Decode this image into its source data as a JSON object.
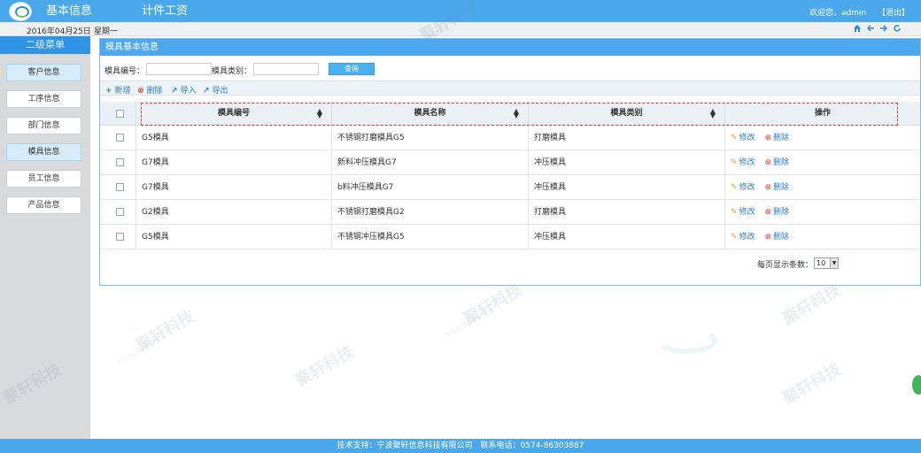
{
  "header": {
    "nav": [
      "基本信息",
      "计件工资"
    ],
    "welcome": "欢迎您，admin",
    "logout": "【退出】"
  },
  "datebar": {
    "date": "2016年04月25日",
    "weekday": "星期一",
    "icons": [
      "home-icon",
      "back-arrow-icon",
      "forward-arrow-icon",
      "refresh-icon"
    ]
  },
  "sidebar": {
    "title": "二级菜单",
    "items": [
      {
        "label": "客户信息",
        "active": true
      },
      {
        "label": "工序信息",
        "active": false
      },
      {
        "label": "部门信息",
        "active": false
      },
      {
        "label": "模具信息",
        "active": true
      },
      {
        "label": "员工信息",
        "active": false
      },
      {
        "label": "产品信息",
        "active": false
      }
    ]
  },
  "panel": {
    "title": "模具基本信息",
    "search": {
      "code_label": "模具编号：",
      "type_label": "模具类别：",
      "code_value": "",
      "type_value": "",
      "button": "查询"
    },
    "toolbar": {
      "add": "新增",
      "delete": "删除",
      "import": "导入",
      "export": "导出"
    },
    "table": {
      "columns": [
        "模具编号",
        "模具名称",
        "模具类别",
        "操作"
      ],
      "rows": [
        {
          "code": "G5模具",
          "name": "不锈钢打磨模具G5",
          "type": "打磨模具",
          "edit": "修改",
          "del": "删除"
        },
        {
          "code": "G7模具",
          "name": "新料冲压模具G7",
          "type": "冲压模具",
          "edit": "修改",
          "del": "删除"
        },
        {
          "code": "G7模具",
          "name": "b料冲压模具G7",
          "type": "冲压模具",
          "edit": "修改",
          "del": "删除"
        },
        {
          "code": "G2模具",
          "name": "不锈钢打磨模具G2",
          "type": "打磨模具",
          "edit": "修改",
          "del": "删除"
        },
        {
          "code": "G5模具",
          "name": "不锈钢冲压模具G5",
          "type": "冲压模具",
          "edit": "修改",
          "del": "删除"
        }
      ]
    },
    "pager": {
      "label": "每页显示条数：",
      "value": "10"
    }
  },
  "watermark": {
    "text": "聚轩科技",
    "sub": "NB.JUXUANKEJI"
  },
  "footer": {
    "text": "技术支持：宁波聚轩信息科技有限公司　联系电话：0574-86303887"
  },
  "colors": {
    "header_blue": "#49a7ec",
    "sidebar_title": "#2f94e6",
    "active_item": "#d6ecfb",
    "highlight_dash": "#e23b3b"
  }
}
